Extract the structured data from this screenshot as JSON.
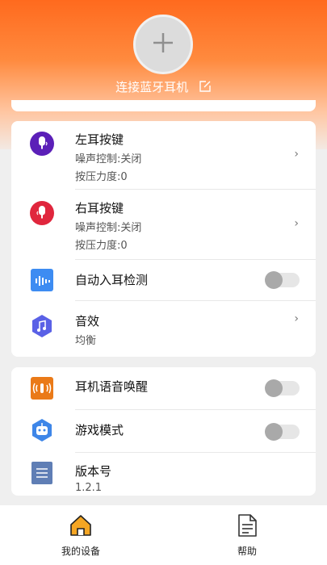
{
  "header": {
    "connect_label": "连接蓝牙耳机",
    "plus_icon": "plus-icon",
    "edit_icon": "edit-icon",
    "gradient_colors": [
      "#ff6a1e",
      "#ffc6a2"
    ]
  },
  "settings_group_1": [
    {
      "title": "左耳按键",
      "sub1": "噪声控制:关闭",
      "sub2": "按压力度:0",
      "icon": "left-earbud-icon",
      "color": "#5b1fb8"
    },
    {
      "title": "右耳按键",
      "sub1": "噪声控制:关闭",
      "sub2": "按压力度:0",
      "icon": "right-earbud-icon",
      "color": "#e0263d"
    },
    {
      "title": "自动入耳检测",
      "icon": "voice-wave-icon",
      "color": "#3d8cf2",
      "toggle": false
    },
    {
      "title": "音效",
      "sub1": "均衡",
      "icon": "music-note-icon",
      "color": "#5a61e6"
    }
  ],
  "settings_group_2": [
    {
      "title": "耳机语音唤醒",
      "icon": "voice-wake-icon",
      "color": "#ea7a18",
      "toggle": false
    },
    {
      "title": "游戏模式",
      "icon": "game-robot-icon",
      "color": "#3e86e8",
      "toggle": false
    },
    {
      "title": "版本号",
      "sub1": "1.2.1",
      "icon": "document-icon",
      "color": "#5f7eb5"
    }
  ],
  "bottom_nav": {
    "items": [
      {
        "label": "我的设备",
        "icon": "home-icon",
        "active": true
      },
      {
        "label": "帮助",
        "icon": "help-doc-icon",
        "active": false
      }
    ],
    "accent_color": "#f5a623"
  }
}
